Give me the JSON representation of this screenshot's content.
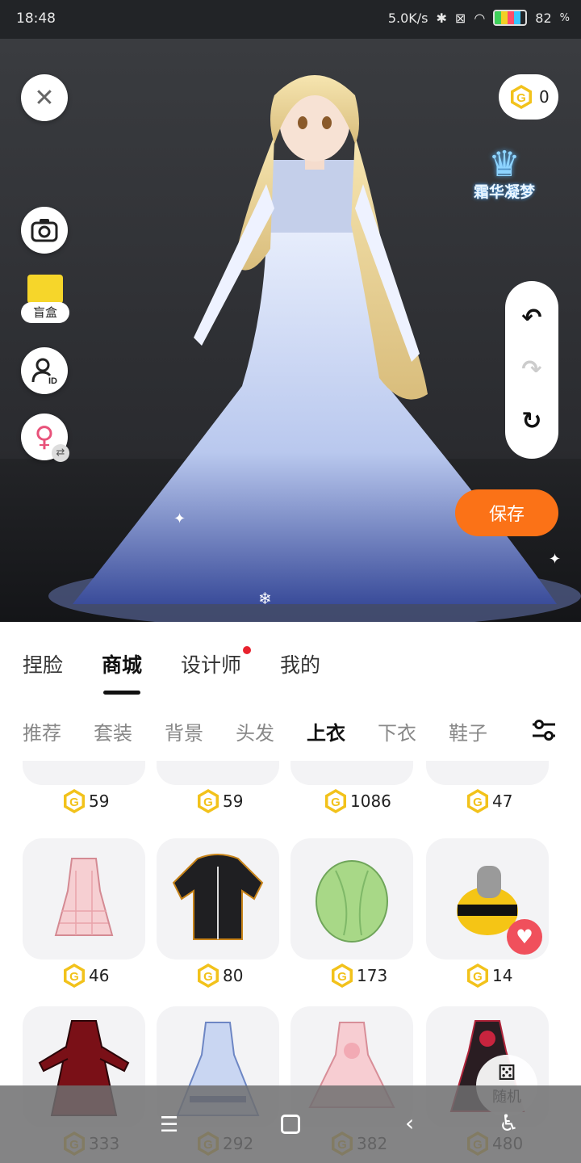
{
  "status": {
    "time": "18:48",
    "net_speed": "5.0K/s",
    "battery": "82",
    "battery_unit": "%"
  },
  "stage": {
    "coin_balance": "0",
    "logo_text": "霜华凝梦",
    "blind_box_label": "盲盒",
    "save_label": "保存"
  },
  "main_tabs": [
    {
      "label": "捏脸"
    },
    {
      "label": "商城"
    },
    {
      "label": "设计师"
    },
    {
      "label": "我的"
    }
  ],
  "sub_tabs": [
    {
      "label": "推荐"
    },
    {
      "label": "套装"
    },
    {
      "label": "背景"
    },
    {
      "label": "头发"
    },
    {
      "label": "上衣"
    },
    {
      "label": "下衣"
    },
    {
      "label": "鞋子"
    }
  ],
  "items": [
    {
      "price": "59",
      "icon": "partial-item-icon"
    },
    {
      "price": "59",
      "icon": "partial-item-icon"
    },
    {
      "price": "1086",
      "icon": "partial-item-icon"
    },
    {
      "price": "47",
      "icon": "partial-item-icon"
    },
    {
      "price": "46",
      "icon": "pink-plaid-dress-icon"
    },
    {
      "price": "80",
      "icon": "black-hoodie-icon"
    },
    {
      "price": "173",
      "icon": "green-cabbage-icon"
    },
    {
      "price": "14",
      "icon": "bee-costume-icon"
    },
    {
      "price": "333",
      "icon": "red-coat-icon"
    },
    {
      "price": "292",
      "icon": "blue-gown-icon"
    },
    {
      "price": "382",
      "icon": "pink-lolita-dress-icon"
    },
    {
      "price": "480",
      "icon": "black-gothic-dress-icon"
    }
  ],
  "random_label": "随机",
  "colors": {
    "accent": "#fb7217",
    "coin": "#f2c21b",
    "favorite": "#f0505c",
    "badge": "#e8222e"
  }
}
